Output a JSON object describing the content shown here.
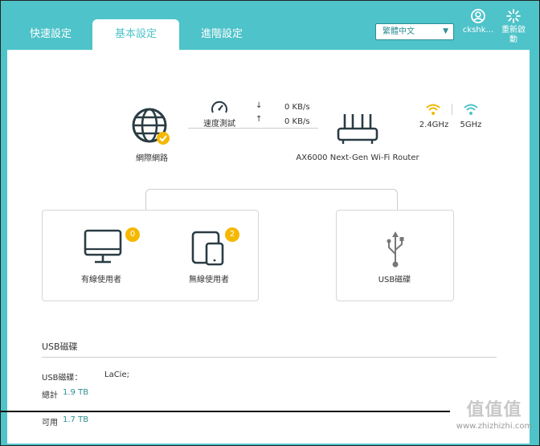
{
  "tabs": [
    "快速設定",
    "基本設定",
    "進階設定"
  ],
  "language": {
    "selected": "繁體中文"
  },
  "header": {
    "user_label": "ckshk...",
    "reboot_label": "重新啟動"
  },
  "topology": {
    "internet_label": "網際網路",
    "speedtest_label": "速度測試",
    "download_speed": "0 KB/s",
    "upload_speed": "0 KB/s",
    "router_model": "AX6000 Next-Gen Wi-Fi Router",
    "band_24_label": "2.4GHz",
    "band_5_label": "5GHz",
    "wired_label": "有線使用者",
    "wired_count": "0",
    "wireless_label": "無線使用者",
    "wireless_count": "2",
    "usb_label": "USB磁碟"
  },
  "usb_section": {
    "title": "USB磁碟",
    "disk_label": "USB磁碟：",
    "disk_value": "LaCie;",
    "total_label": "總計",
    "total_value": "1.9 TB",
    "avail_label": "可用",
    "avail_value": "1.7 TB"
  },
  "watermark": {
    "big": "值值值",
    "small": "www.zhizhizhi.com"
  },
  "colors": {
    "accent": "#4ec3c9",
    "wifi_warn": "#f5b800",
    "wifi_ok": "#4ec3c9"
  }
}
